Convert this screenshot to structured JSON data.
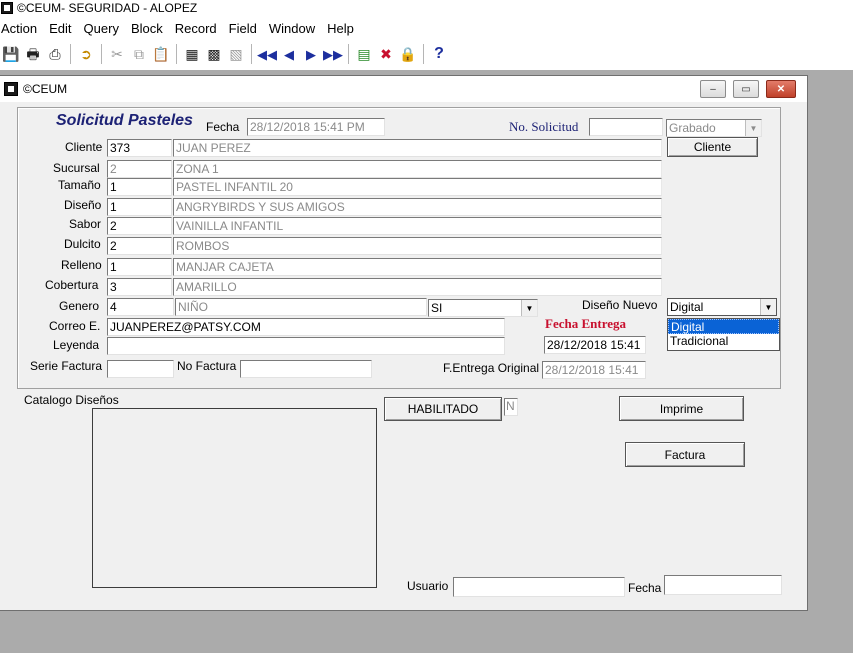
{
  "app": {
    "title": "©CEUM- SEGURIDAD - ALOPEZ"
  },
  "menu": [
    "Action",
    "Edit",
    "Query",
    "Block",
    "Record",
    "Field",
    "Window",
    "Help"
  ],
  "toolbar": {
    "icons": [
      "save-icon",
      "print-icon",
      "print-setup-icon",
      "exit-icon",
      "cut-icon",
      "copy-icon",
      "paste-icon",
      "enter-query-icon",
      "execute-query-icon",
      "cancel-query-icon",
      "first-record-icon",
      "previous-record-icon",
      "next-record-icon",
      "last-record-icon",
      "insert-record-icon",
      "delete-record-icon",
      "lock-record-icon",
      "help-icon"
    ]
  },
  "window": {
    "title": "©CEUM",
    "controls": {
      "minimize": "–",
      "restore": "▭",
      "close": "✕"
    }
  },
  "form": {
    "title": "Solicitud Pasteles",
    "fecha_label": "Fecha",
    "fecha_value": "28/12/2018 15:41 PM",
    "no_solicitud_label": "No. Solicitud",
    "no_solicitud_value": "",
    "status_value": "Grabado",
    "cliente_button": "Cliente",
    "rows": [
      {
        "label": "Cliente",
        "code": "373",
        "desc": "JUAN PEREZ",
        "code_gray": false
      },
      {
        "label": "Sucursal",
        "code": "2",
        "desc": "ZONA 1",
        "code_gray": true
      },
      {
        "label": "Tamaño",
        "code": "1",
        "desc": "PASTEL INFANTIL 20",
        "code_gray": false
      },
      {
        "label": "Diseño",
        "code": "1",
        "desc": "ANGRYBIRDS Y SUS AMIGOS",
        "code_gray": false
      },
      {
        "label": "Sabor",
        "code": "2",
        "desc": "VAINILLA INFANTIL",
        "code_gray": false
      },
      {
        "label": "Dulcito",
        "code": "2",
        "desc": "ROMBOS",
        "code_gray": false
      },
      {
        "label": "Relleno",
        "code": "1",
        "desc": "MANJAR CAJETA",
        "code_gray": false
      },
      {
        "label": "Cobertura",
        "code": "3",
        "desc": "AMARILLO",
        "code_gray": false
      }
    ],
    "genero": {
      "label": "Genero",
      "code": "4",
      "desc": "NIÑO",
      "select_value": "SI"
    },
    "diseno_nuevo": {
      "label": "Diseño Nuevo",
      "value": "Digital",
      "options": [
        "Digital",
        "Tradicional"
      ],
      "selected_index": 0
    },
    "correo": {
      "label": "Correo E.",
      "value": "JUANPEREZ@PATSY.COM"
    },
    "leyenda": {
      "label": "Leyenda",
      "value": ""
    },
    "fecha_entrega": {
      "label": "Fecha Entrega",
      "value": "28/12/2018 15:41"
    },
    "serie_factura": {
      "label": "Serie Factura",
      "value": ""
    },
    "no_factura": {
      "label": "No Factura",
      "value": ""
    },
    "f_entrega_original": {
      "label": "F.Entrega Original",
      "value": "28/12/2018 15:41"
    },
    "catalogo_label": "Catalogo Diseños",
    "habilitado_button": "HABILITADO",
    "habilitado_value": "N",
    "imprime_button": "Imprime",
    "factura_button": "Factura",
    "usuario": {
      "label": "Usuario",
      "value": ""
    },
    "fecha_footer": {
      "label": "Fecha",
      "value": ""
    }
  }
}
